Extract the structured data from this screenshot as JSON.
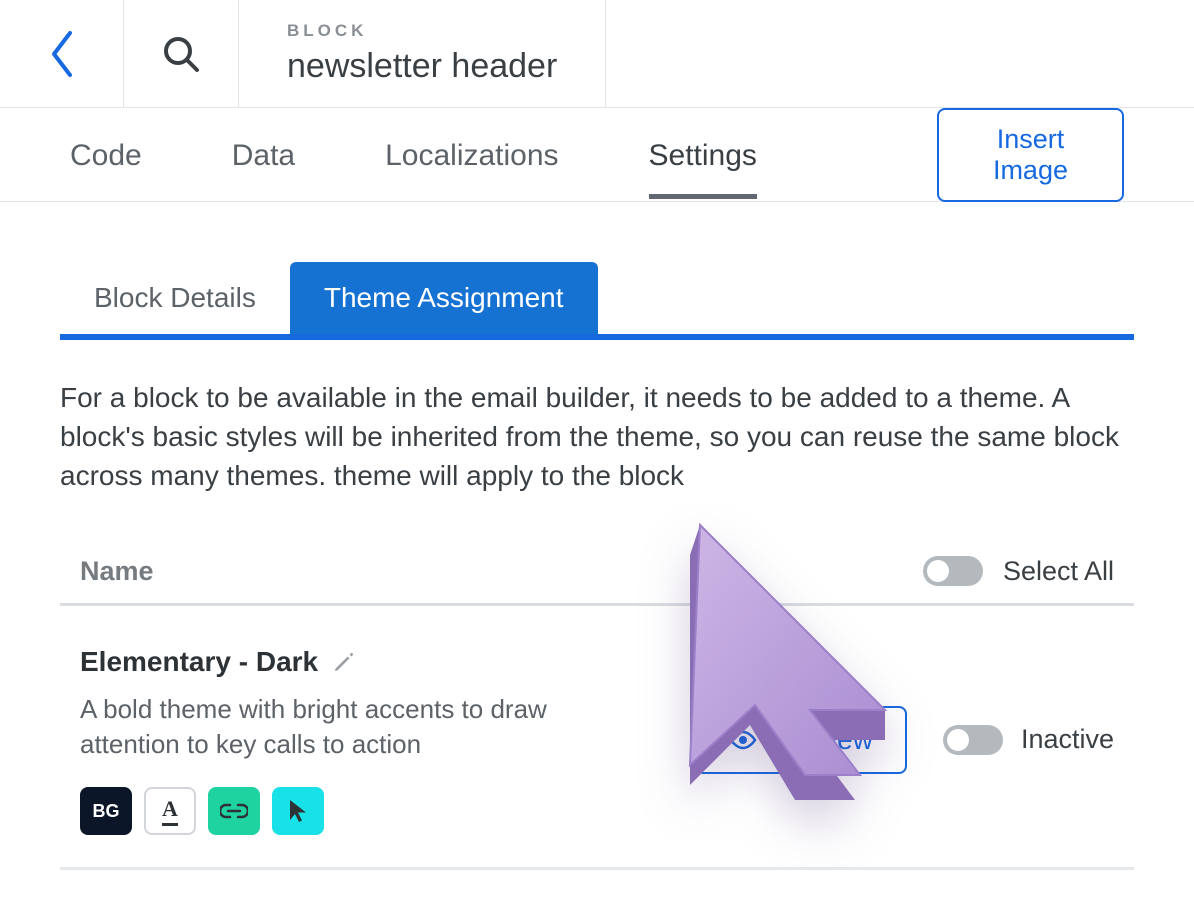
{
  "header": {
    "label": "BLOCK",
    "title": "newsletter header"
  },
  "tabs": {
    "items": [
      "Code",
      "Data",
      "Localizations",
      "Settings"
    ],
    "active_index": 3,
    "insert_image": "Insert Image"
  },
  "subtabs": {
    "items": [
      "Block Details",
      "Theme Assignment"
    ],
    "active_index": 1
  },
  "help_text": "For a block to be available in the email builder, it needs to be added to a theme. A block's basic styles will be inherited from the theme, so you can reuse the same block across many themes. theme will apply to the block",
  "list": {
    "column_name": "Name",
    "select_all": "Select All",
    "themes": [
      {
        "name": "Elementary - Dark",
        "description": "A bold theme with bright accents to draw attention to key calls to action",
        "swatches": {
          "bg": "BG",
          "font": "A"
        },
        "preview_label": "Preview",
        "status_label": "Inactive"
      }
    ]
  },
  "colors": {
    "accent": "#1769e0",
    "swatch_bg": "#0b1628",
    "swatch_link": "#1fd3a0",
    "swatch_cursor": "#19e1e8"
  }
}
